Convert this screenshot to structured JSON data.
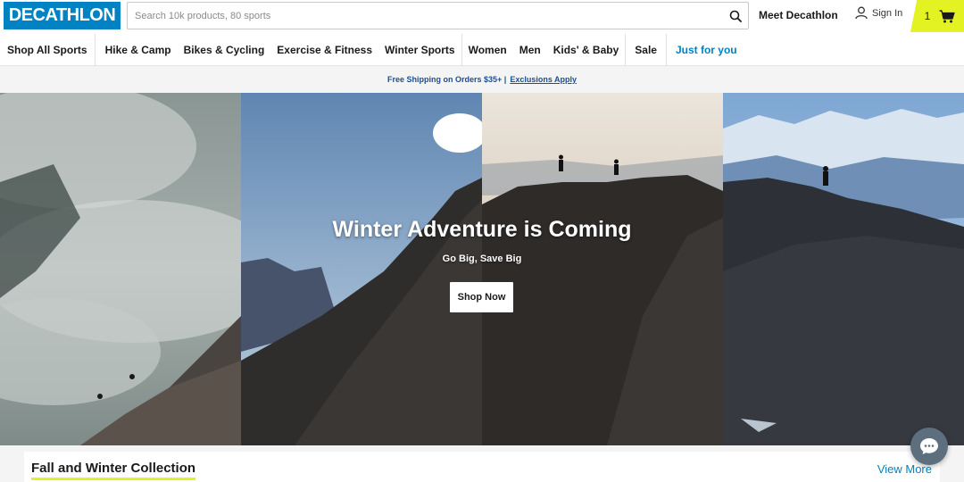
{
  "header": {
    "logo_text": "DECATHLON",
    "search_placeholder": "Search 10k products, 80 sports",
    "meet_label": "Meet Decathlon",
    "signin_label": "Sign In",
    "cart_count": "1"
  },
  "nav": {
    "items": [
      "Shop All Sports",
      "Hike & Camp",
      "Bikes & Cycling",
      "Exercise & Fitness",
      "Winter Sports",
      "Women",
      "Men",
      "Kids' & Baby",
      "Sale",
      "Just for you"
    ]
  },
  "promo": {
    "text": "Free Shipping on Orders $35+ |",
    "link": "Exclusions Apply"
  },
  "hero": {
    "title": "Winter Adventure is Coming",
    "subtitle": "Go Big, Save Big",
    "button": "Shop Now"
  },
  "section": {
    "title": "Fall and Winter Collection",
    "view_more": "View More"
  },
  "colors": {
    "brand_blue": "#0082c3",
    "accent_yellow": "#e3f223",
    "promo_text": "#1b4f92"
  },
  "icons": {
    "search": "search-icon",
    "user": "user-icon",
    "cart": "cart-icon",
    "chat": "chat-icon"
  }
}
